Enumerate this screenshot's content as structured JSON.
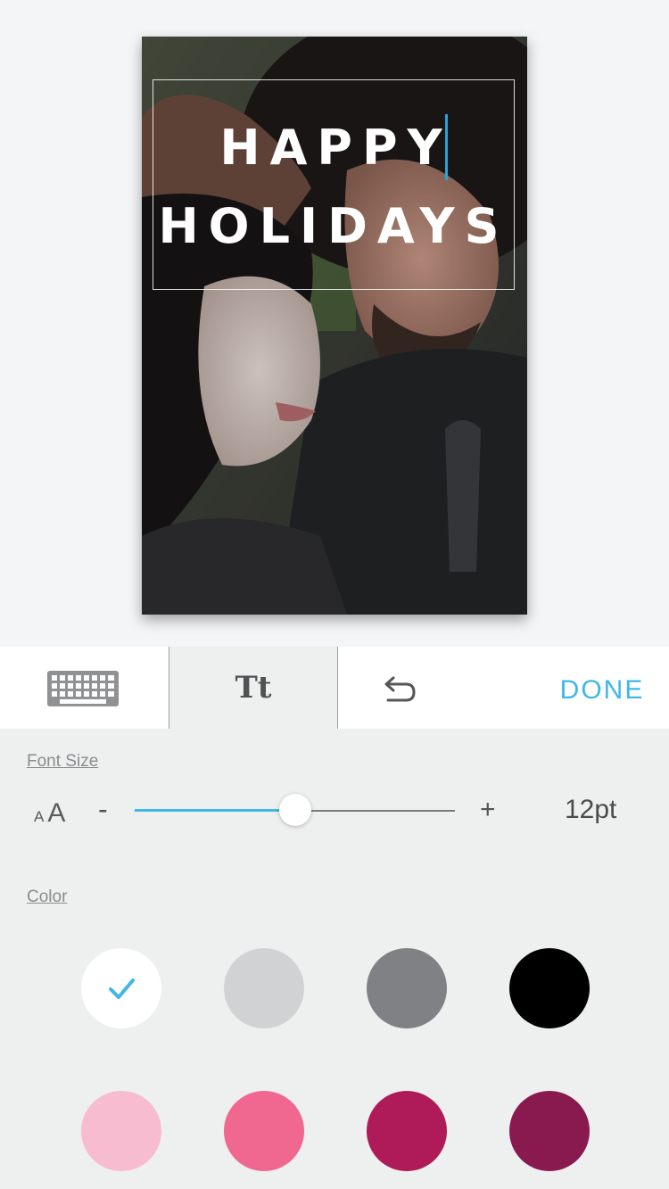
{
  "card": {
    "line1": "HAPPY",
    "line2": "HOLIDAYS"
  },
  "toolbar": {
    "keyboard_icon": "keyboard-icon",
    "text_tab_label": "Tt",
    "undo_icon": "undo-icon",
    "done_label": "DONE"
  },
  "font_size": {
    "label": "Font Size",
    "small_a": "A",
    "big_a": "A",
    "minus": "-",
    "plus": "+",
    "value": "12pt",
    "slider_fraction": 0.5
  },
  "color": {
    "label": "Color",
    "swatches": [
      "#ffffff",
      "#d1d2d4",
      "#808184",
      "#000000",
      "#f7bcd0",
      "#f06790",
      "#ae1b58",
      "#891a50"
    ],
    "selected_index": 0,
    "check_color": "#3fb7e8"
  }
}
